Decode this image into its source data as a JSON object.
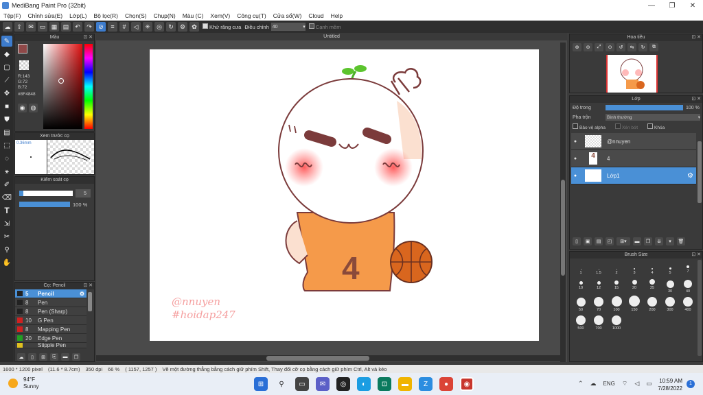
{
  "window": {
    "title": "MediBang Paint Pro (32bit)",
    "minimize": "—",
    "maximize": "❐",
    "close": "✕"
  },
  "menu": [
    "Tệp(F)",
    "Chỉnh sửa(E)",
    "Lớp(L)",
    "Bộ lọc(R)",
    "Chọn(S)",
    "Chụp(N)",
    "Màu (C)",
    "Xem(V)",
    "Công cụ(T)",
    "Cửa sổ(W)",
    "Cloud",
    "Help"
  ],
  "toolbar": {
    "antialias_label": "Khử răng cưa",
    "adjust_label": "Điều chỉnh",
    "adjust_value": "40",
    "smooth_label": "Cạnh mềm"
  },
  "color_panel": {
    "title": "Màu",
    "r": "R:143",
    "g": "G:72",
    "b": "B:72",
    "hex": "#8F4848",
    "current_color": "#8F4848",
    "secondary_color": "#2e9a2e"
  },
  "brush_preview": {
    "title": "Xem trước cọ",
    "size_label": "0.36mm"
  },
  "brush_control": {
    "title": "Kiểm soát cọ",
    "size_value": "5",
    "opacity_value": "100 %"
  },
  "brush_list": {
    "title": "Cọ: Pencil",
    "items": [
      {
        "size": "5",
        "name": "Pencil",
        "color": "#222222"
      },
      {
        "size": "8",
        "name": "Pen",
        "color": "#222222"
      },
      {
        "size": "8",
        "name": "Pen (Sharp)",
        "color": "#222222"
      },
      {
        "size": "10",
        "name": "G Pen",
        "color": "#d02020"
      },
      {
        "size": "8",
        "name": "Mapping Pen",
        "color": "#d02020"
      },
      {
        "size": "20",
        "name": "Edge Pen",
        "color": "#22a022"
      },
      {
        "size": "",
        "name": "Stipple Pen",
        "color": "#e0c020"
      }
    ]
  },
  "document": {
    "tab_title": "Untitled",
    "watermark_line1": "@nnuyen",
    "watermark_line2": "#hoidap247",
    "jersey_number": "4"
  },
  "navigator": {
    "title": "Hoa tiêu"
  },
  "layers": {
    "title": "Lớp",
    "opacity_label": "Độ trong",
    "opacity_value": "100 %",
    "opacity_fraction": 1.0,
    "blend_label": "Pha trộn",
    "blend_value": "Bình thường",
    "protect_alpha": "Bảo vệ alpha",
    "clipping": "Xén bớt",
    "lock": "Khóa",
    "items": [
      {
        "name": "@nnuyen"
      },
      {
        "name": "4"
      },
      {
        "name": "Lớp1"
      }
    ]
  },
  "brush_size": {
    "title": "Brush Size",
    "sizes": [
      "1",
      "1.5",
      "2",
      "3",
      "4",
      "5",
      "7",
      "10",
      "12",
      "15",
      "20",
      "25",
      "30",
      "40",
      "50",
      "70",
      "100",
      "150",
      "200",
      "300",
      "400",
      "500",
      "700",
      "1000"
    ]
  },
  "status": {
    "size": "1600 * 1200 pixel",
    "physical": "(11.6 * 8.7cm)",
    "dpi": "350 dpi",
    "zoom": "66 %",
    "coords": "( 1157, 1257 )",
    "hint": "Vẽ một đường thẳng bằng cách giữ phím Shift, Thay đổi cỡ cọ bằng cách giữ phím Ctrl, Alt và kéo"
  },
  "taskbar": {
    "temp": "94°F",
    "weather": "Sunny",
    "lang": "ENG",
    "time": "10:59 AM",
    "date": "7/28/2022"
  }
}
